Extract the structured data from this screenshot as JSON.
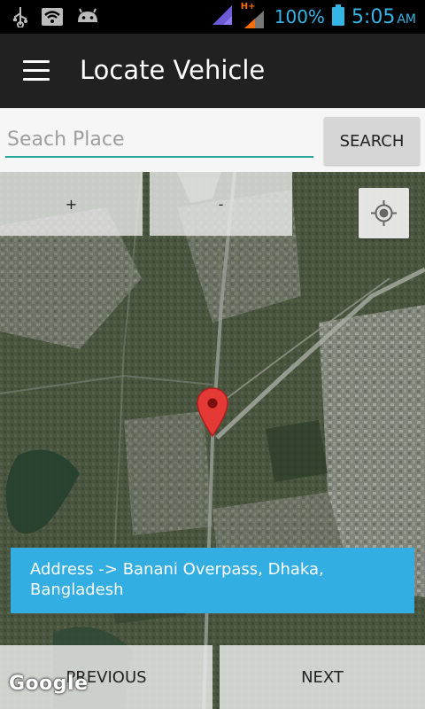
{
  "status_bar": {
    "battery_percent": "100%",
    "time": "5:05",
    "ampm": "AM",
    "network_type": "H+",
    "icons": [
      "usb-icon",
      "wifi-icon",
      "android-icon",
      "signal-icon",
      "battery-icon"
    ],
    "accent_color": "#33b5e5"
  },
  "app_bar": {
    "title": "Locate Vehicle",
    "menu_icon": "hamburger-menu-icon",
    "background": "#212121"
  },
  "search": {
    "placeholder": "Seach Place",
    "value": "",
    "button_label": "SEARCH",
    "underline_color": "#26a69a"
  },
  "map": {
    "zoom_in_label": "+",
    "zoom_out_label": "-",
    "locate_icon": "my-location-icon",
    "marker_icon": "map-pin-icon",
    "marker_color": "#e53935",
    "address_text": "Address -> Banani Overpass, Dhaka, Bangladesh",
    "address_bg": "#33aee2",
    "attribution": "Google"
  },
  "navigation": {
    "previous_label": "PREVIOUS",
    "next_label": "NEXT"
  }
}
